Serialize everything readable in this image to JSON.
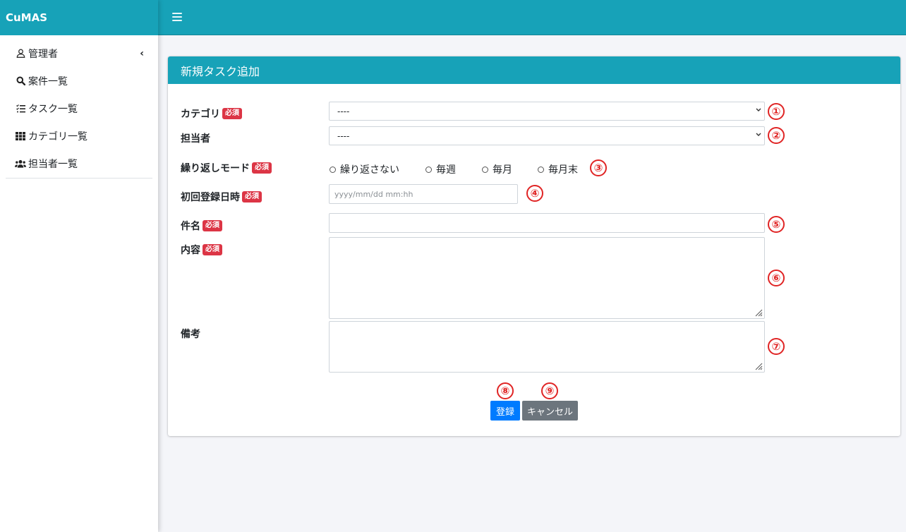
{
  "brand": "CuMAS",
  "sidebar": {
    "items": [
      {
        "label": "管理者"
      },
      {
        "label": "案件一覧"
      },
      {
        "label": "タスク一覧"
      },
      {
        "label": "カテゴリ一覧"
      },
      {
        "label": "担当者一覧"
      }
    ]
  },
  "form": {
    "title": "新規タスク追加",
    "required_badge": "必須",
    "category_label": "カテゴリ",
    "category_value": "----",
    "assignee_label": "担当者",
    "assignee_value": "----",
    "repeat_label": "繰り返しモード",
    "repeat_options": [
      "繰り返さない",
      "毎週",
      "毎月",
      "毎月末"
    ],
    "first_date_label": "初回登録日時",
    "first_date_placeholder": "yyyy/mm/dd mm:hh",
    "subject_label": "件名",
    "content_label": "内容",
    "notes_label": "備考",
    "submit_label": "登録",
    "cancel_label": "キャンセル"
  },
  "annotations": [
    "①",
    "②",
    "③",
    "④",
    "⑤",
    "⑥",
    "⑦",
    "⑧",
    "⑨"
  ],
  "colors": {
    "accent": "#17a2b8",
    "required": "#dc3545",
    "primary": "#007bff",
    "secondary": "#6c757d",
    "annotation": "#e02424"
  },
  "icons": [
    "user-icon",
    "search-icon",
    "task-list-icon",
    "grid-icon",
    "users-icon",
    "chevron-left-icon",
    "hamburger-icon",
    "chevron-down-icon",
    "resize-grip-icon"
  ]
}
